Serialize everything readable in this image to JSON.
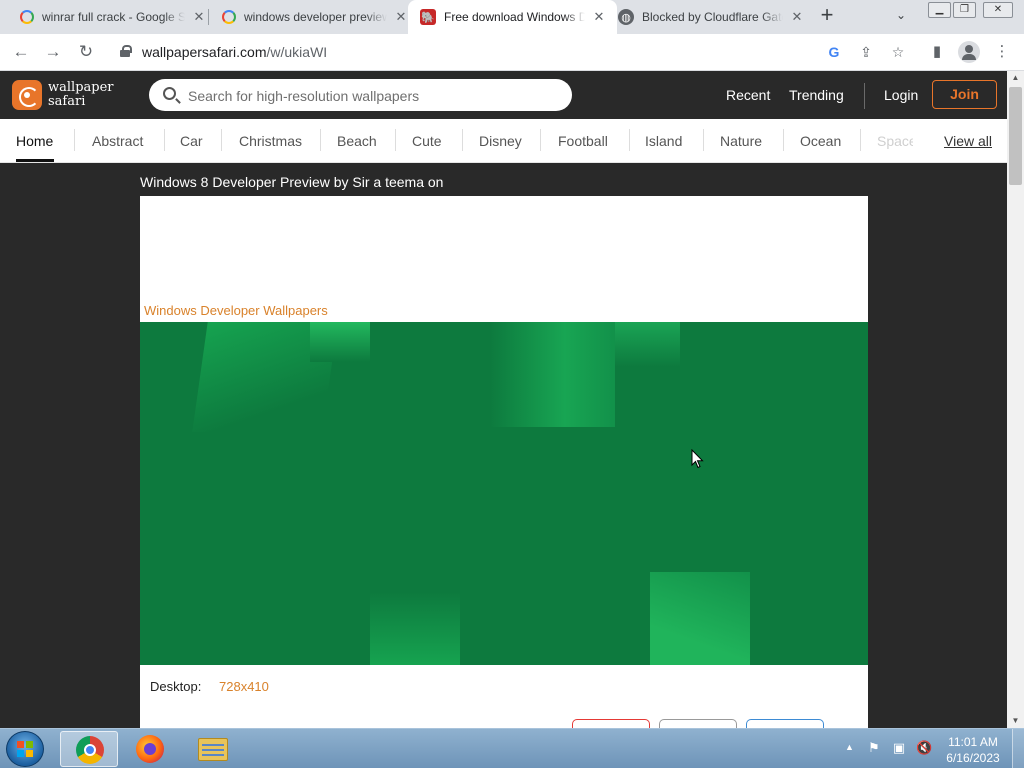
{
  "browser": {
    "tabs": [
      {
        "title": "winrar full crack - Google Search",
        "icon": "google-icon"
      },
      {
        "title": "windows developer preview",
        "icon": "google-icon"
      },
      {
        "title": "Free download Windows Developer",
        "icon": "wallpapersafari-icon"
      },
      {
        "title": "Blocked by Cloudflare Gateway",
        "icon": "globe-icon"
      }
    ],
    "new_tab_glyph": "+",
    "tab_search_glyph": "⌄",
    "url_host": "wallpapersafari.com",
    "url_path": "/w/ukiaWI"
  },
  "site": {
    "logo_line1": "wallpaper",
    "logo_line2": "safari",
    "search_placeholder": "Search for high-resolution wallpapers",
    "nav": {
      "recent": "Recent",
      "trending": "Trending",
      "login": "Login",
      "join": "Join"
    },
    "accent_color": "#e8752a",
    "categories": [
      "Home",
      "Abstract",
      "Car",
      "Christmas",
      "Beach",
      "Cute",
      "Disney",
      "Football",
      "Island",
      "Nature",
      "Ocean",
      "Space"
    ],
    "view_all": "View all"
  },
  "content": {
    "page_title": "Windows 8 Developer Preview by Sir a teema on",
    "wallpaper_link": "Windows Developer Wallpapers",
    "desktop_label": "Desktop:",
    "desktop_resolution": "728x410",
    "wallpaper_color": "#0d7a3e"
  },
  "taskbar": {
    "time": "11:01 AM",
    "date": "6/16/2023",
    "apps": [
      "chrome-icon",
      "firefox-icon",
      "file-explorer-icon"
    ]
  }
}
